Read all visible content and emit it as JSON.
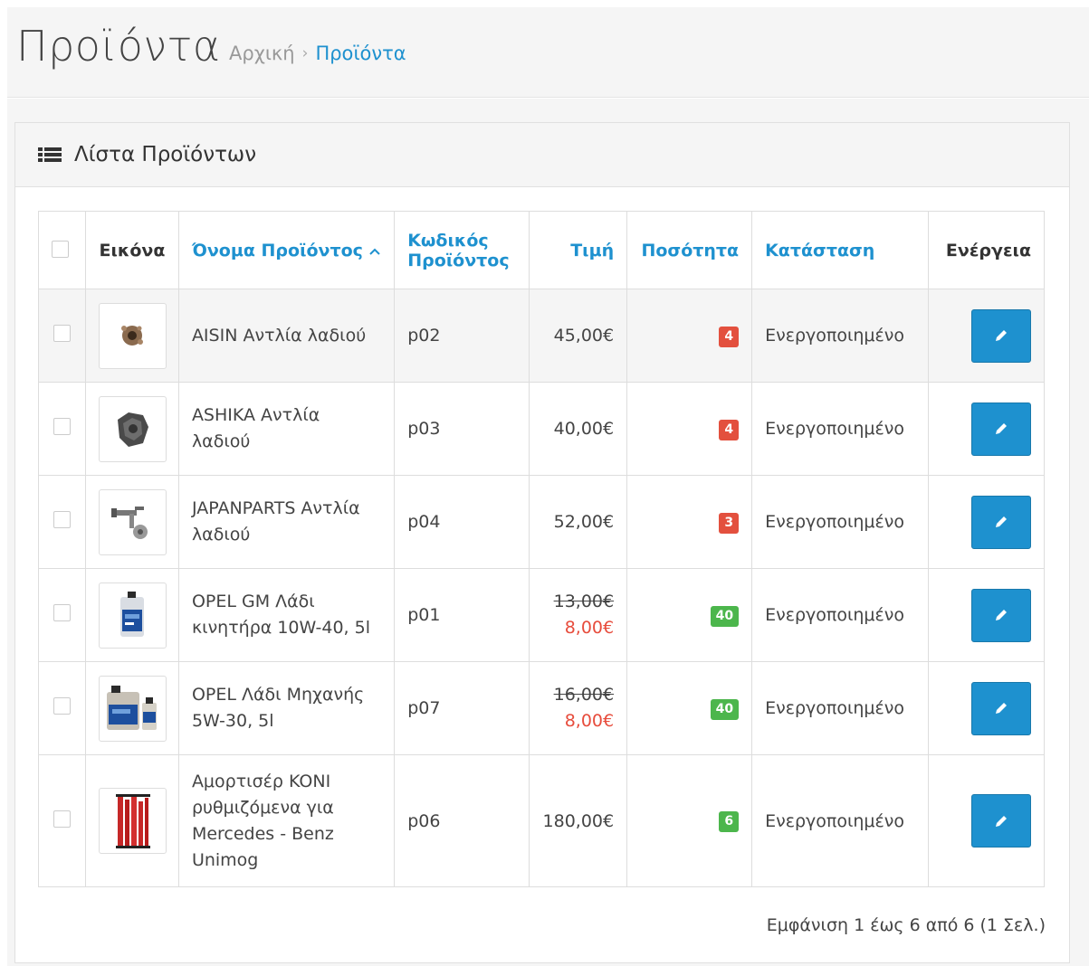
{
  "header": {
    "title": "Προϊόντα",
    "breadcrumb": [
      {
        "label": "Αρχική"
      },
      {
        "label": "Προϊόντα"
      }
    ],
    "breadcrumb_separator": "›"
  },
  "panel": {
    "title": "Λίστα Προϊόντων",
    "icon": "list-icon"
  },
  "table": {
    "columns": {
      "image": "Εικόνα",
      "name": "Όνομα Προϊόντος",
      "sort_indicator": "^",
      "model": "Κωδικός Προϊόντος",
      "price": "Τιμή",
      "quantity": "Ποσότητα",
      "status": "Κατάσταση",
      "action": "Ενέργεια"
    },
    "rows": [
      {
        "name": "AISIN Αντλία λαδιού",
        "model": "p02",
        "price": "45,00€",
        "special": "",
        "quantity": "4",
        "qty_color": "#e3503e",
        "status": "Ενεργοποιημένο",
        "icon": "oil-pump-image"
      },
      {
        "name": "ASHIKA Αντλία λαδιού",
        "model": "p03",
        "price": "40,00€",
        "special": "",
        "quantity": "4",
        "qty_color": "#e3503e",
        "status": "Ενεργοποιημένο",
        "icon": "oil-pump-image"
      },
      {
        "name": "JAPANPARTS Αντλία λαδιού",
        "model": "p04",
        "price": "52,00€",
        "special": "",
        "quantity": "3",
        "qty_color": "#e3503e",
        "status": "Ενεργοποιημένο",
        "icon": "oil-pump-image"
      },
      {
        "name": "OPEL GM Λάδι κινητήρα 10W-40, 5l",
        "model": "p01",
        "price": "13,00€",
        "special": "8,00€",
        "quantity": "40",
        "qty_color": "#4cb64c",
        "status": "Ενεργοποιημένο",
        "icon": "oil-can-image"
      },
      {
        "name": "OPEL Λάδι Μηχανής 5W-30, 5l",
        "model": "p07",
        "price": "16,00€",
        "special": "8,00€",
        "quantity": "40",
        "qty_color": "#4cb64c",
        "status": "Ενεργοποιημένο",
        "icon": "oil-can-image"
      },
      {
        "name": "Αμορτισέρ KONI ρυθμιζόμενα για Mercedes - Benz Unimog",
        "model": "p06",
        "price": "180,00€",
        "special": "",
        "quantity": "6",
        "qty_color": "#4cb64c",
        "status": "Ενεργοποιημένο",
        "icon": "shock-absorber-image"
      }
    ]
  },
  "pagination": {
    "text": "Εμφάνιση 1 έως 6 από 6 (1 Σελ.)"
  },
  "colors": {
    "link": "#1e91cf",
    "danger": "#e3503e",
    "success": "#4cb64c",
    "special_price": "#e74c3c"
  }
}
